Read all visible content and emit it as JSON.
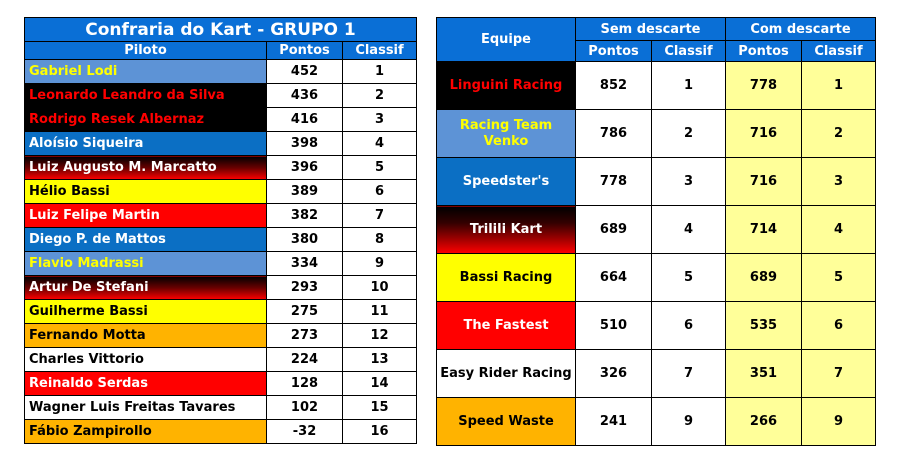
{
  "grupo": {
    "title": "Confraria do Kart - GRUPO 1",
    "headers": {
      "piloto": "Piloto",
      "pontos": "Pontos",
      "classif": "Classif"
    },
    "rows": [
      {
        "piloto": "Gabriel Lodi",
        "pontos": "452",
        "classif": "1",
        "style": "c-lightblue"
      },
      {
        "piloto": "Leonardo Leandro da Silva",
        "pontos": "436",
        "classif": "2",
        "style": "c-black-red"
      },
      {
        "piloto": "Rodrigo Resek Albernaz",
        "pontos": "416",
        "classif": "3",
        "style": "c-black-red"
      },
      {
        "piloto": "Aloísio Siqueira",
        "pontos": "398",
        "classif": "4",
        "style": "c-blue"
      },
      {
        "piloto": "Luiz Augusto M. Marcatto",
        "pontos": "396",
        "classif": "5",
        "style": "c-grad"
      },
      {
        "piloto": "Hélio Bassi",
        "pontos": "389",
        "classif": "6",
        "style": "c-yellow"
      },
      {
        "piloto": "Luiz Felipe Martin",
        "pontos": "382",
        "classif": "7",
        "style": "c-red"
      },
      {
        "piloto": "Diego P. de Mattos",
        "pontos": "380",
        "classif": "8",
        "style": "c-blue"
      },
      {
        "piloto": "Flavio Madrassi",
        "pontos": "334",
        "classif": "9",
        "style": "c-lightblue"
      },
      {
        "piloto": "Artur De Stefani",
        "pontos": "293",
        "classif": "10",
        "style": "c-grad"
      },
      {
        "piloto": "Guilherme Bassi",
        "pontos": "275",
        "classif": "11",
        "style": "c-yellow"
      },
      {
        "piloto": "Fernando Motta",
        "pontos": "273",
        "classif": "12",
        "style": "c-orange"
      },
      {
        "piloto": "Charles Vittorio",
        "pontos": "224",
        "classif": "13",
        "style": "c-white"
      },
      {
        "piloto": "Reinaldo Serdas",
        "pontos": "128",
        "classif": "14",
        "style": "c-red"
      },
      {
        "piloto": "Wagner Luis Freitas Tavares",
        "pontos": "102",
        "classif": "15",
        "style": "c-white"
      },
      {
        "piloto": "Fábio Zampirollo",
        "pontos": "-32",
        "classif": "16",
        "style": "c-orange"
      }
    ]
  },
  "equipes": {
    "headers": {
      "equipe": "Equipe",
      "sem_descarte": "Sem descarte",
      "com_descarte": "Com descarte",
      "pontos": "Pontos",
      "classif": "Classif"
    },
    "rows": [
      {
        "equipe": "Linguini Racing",
        "sem_pontos": "852",
        "sem_classif": "1",
        "com_pontos": "778",
        "com_classif": "1",
        "style": "c-black-red"
      },
      {
        "equipe": "Racing Team Venko",
        "sem_pontos": "786",
        "sem_classif": "2",
        "com_pontos": "716",
        "com_classif": "2",
        "style": "c-lightblue-w"
      },
      {
        "equipe": "Speedster's",
        "sem_pontos": "778",
        "sem_classif": "3",
        "com_pontos": "716",
        "com_classif": "3",
        "style": "c-blue"
      },
      {
        "equipe": "Trilili Kart",
        "sem_pontos": "689",
        "sem_classif": "4",
        "com_pontos": "714",
        "com_classif": "4",
        "style": "c-grad2"
      },
      {
        "equipe": "Bassi Racing",
        "sem_pontos": "664",
        "sem_classif": "5",
        "com_pontos": "689",
        "com_classif": "5",
        "style": "c-yellow"
      },
      {
        "equipe": "The Fastest",
        "sem_pontos": "510",
        "sem_classif": "6",
        "com_pontos": "535",
        "com_classif": "6",
        "style": "c-red"
      },
      {
        "equipe": "Easy Rider Racing",
        "sem_pontos": "326",
        "sem_classif": "7",
        "com_pontos": "351",
        "com_classif": "7",
        "style": "c-white"
      },
      {
        "equipe": "Speed Waste",
        "sem_pontos": "241",
        "sem_classif": "9",
        "com_pontos": "266",
        "com_classif": "9",
        "style": "c-orange"
      }
    ]
  }
}
